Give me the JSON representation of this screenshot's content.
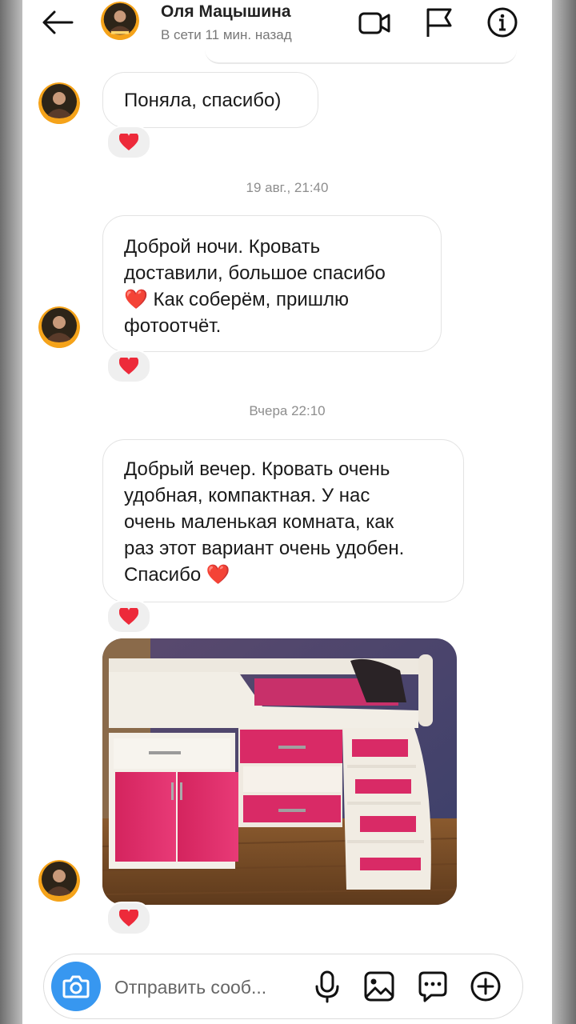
{
  "header": {
    "contact_name": "Оля Мацышина",
    "status": "В сети 11 мин. назад",
    "icons": [
      "arrow-back-icon",
      "video-call-icon",
      "flag-icon",
      "info-icon"
    ]
  },
  "messages": [
    {
      "text": "Поняла, спасибо)",
      "reaction": "❤️"
    },
    {
      "timestamp": "19 авг., 21:40"
    },
    {
      "lines": [
        "Доброй ночи. Кровать",
        "доставили, большое спасибо",
        "❤️ Как соберём, пришлю",
        "фотоотчёт."
      ],
      "reaction": "❤️"
    },
    {
      "timestamp": "Вчера 22:10"
    },
    {
      "lines": [
        "Добрый вечер. Кровать очень",
        "удобная, компактная. У нас",
        "очень маленькая комната, как",
        "раз этот вариант очень удобен.",
        "Спасибо ❤️"
      ],
      "reaction": "❤️"
    },
    {
      "image": "photo-loft-bed-pink-white",
      "reaction": "❤️"
    }
  ],
  "composer": {
    "placeholder": "Отправить сооб...",
    "icons": [
      "camera-icon",
      "mic-icon",
      "gallery-icon",
      "sticker-icon",
      "plus-icon"
    ]
  },
  "colors": {
    "accent": "#3797f0",
    "heart": "#ed2a3a",
    "bubble_border": "#e3e3e3"
  }
}
